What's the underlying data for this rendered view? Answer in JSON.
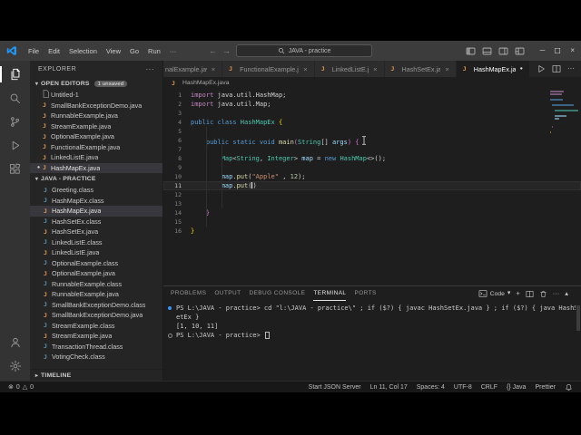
{
  "window": {
    "menus": [
      "File",
      "Edit",
      "Selection",
      "View",
      "Go",
      "Run",
      "···"
    ],
    "search_title": "JAVA - practice",
    "layout_icons": [
      "toggle-sidebar",
      "toggle-panel",
      "toggle-secondary-sidebar",
      "customize-layout"
    ],
    "window_controls": [
      "minimize",
      "maximize",
      "close"
    ]
  },
  "activity_bar": {
    "top": [
      "explorer",
      "search",
      "source-control",
      "run-debug",
      "extensions"
    ],
    "bottom": [
      "account",
      "settings"
    ],
    "active": "explorer"
  },
  "sidebar": {
    "title": "EXPLORER",
    "open_editors": {
      "label": "OPEN EDITORS",
      "badge": "1 unsaved",
      "items": [
        {
          "name": "Untitled-1",
          "icon": "file"
        },
        {
          "name": "SmallBankExceptionDemo.java",
          "icon": "java"
        },
        {
          "name": "RunnableExample.java",
          "icon": "java"
        },
        {
          "name": "StreamExample.java",
          "icon": "java"
        },
        {
          "name": "OptionalExample.java",
          "icon": "java"
        },
        {
          "name": "FunctionalExample.java",
          "icon": "java"
        },
        {
          "name": "LinkedListE.java",
          "icon": "java"
        },
        {
          "name": "HashMapEx.java",
          "icon": "java",
          "modified": true,
          "active": true
        }
      ]
    },
    "project": {
      "label": "JAVA - PRACTICE",
      "items": [
        {
          "name": "Greeting.class",
          "icon": "class"
        },
        {
          "name": "HashMapEx.class",
          "icon": "class"
        },
        {
          "name": "HashMapEx.java",
          "icon": "java",
          "selected": true
        },
        {
          "name": "HashSetEx.class",
          "icon": "class"
        },
        {
          "name": "HashSetEx.java",
          "icon": "java"
        },
        {
          "name": "LinkedListE.class",
          "icon": "class"
        },
        {
          "name": "LinkedListE.java",
          "icon": "java"
        },
        {
          "name": "OptionalExample.class",
          "icon": "class"
        },
        {
          "name": "OptionalExample.java",
          "icon": "java"
        },
        {
          "name": "RunnableExample.class",
          "icon": "class"
        },
        {
          "name": "RunnableExample.java",
          "icon": "java"
        },
        {
          "name": "SmallBankExceptionDemo.class",
          "icon": "class"
        },
        {
          "name": "SmallBankExceptionDemo.java",
          "icon": "java"
        },
        {
          "name": "StreamExample.class",
          "icon": "class"
        },
        {
          "name": "StreamExample.java",
          "icon": "java"
        },
        {
          "name": "TransactionThread.class",
          "icon": "class"
        },
        {
          "name": "VotingCheck.class",
          "icon": "class"
        }
      ]
    },
    "timeline_label": "TIMELINE"
  },
  "editor": {
    "tabs": [
      {
        "label": "nalExample.java",
        "partial": true
      },
      {
        "label": "FunctionalExample.java",
        "icon": "java"
      },
      {
        "label": "LinkedListE.jav",
        "icon": "java"
      },
      {
        "label": "HashSetEx.java",
        "icon": "java"
      },
      {
        "label": "HashMapEx.java",
        "icon": "java",
        "active": true,
        "modified": true
      }
    ],
    "tab_actions": [
      "run",
      "split-editor",
      "more"
    ],
    "breadcrumb": "HashMapEx.java",
    "lines": [
      {
        "n": "1",
        "seg": [
          [
            "import ",
            "ctrl"
          ],
          [
            "java.util.HashMap;",
            "plain"
          ]
        ]
      },
      {
        "n": "2",
        "seg": [
          [
            "import ",
            "ctrl"
          ],
          [
            "java.util.Map;",
            "plain"
          ]
        ]
      },
      {
        "n": "3",
        "seg": []
      },
      {
        "n": "4",
        "seg": [
          [
            "public class ",
            "kw"
          ],
          [
            "HashMapEx ",
            "type"
          ],
          [
            "{",
            "brace1"
          ]
        ]
      },
      {
        "n": "5",
        "seg": []
      },
      {
        "n": "6",
        "seg": [
          [
            "    ",
            "plain"
          ],
          [
            "public static void ",
            "kw"
          ],
          [
            "main",
            "fn"
          ],
          [
            "(",
            "brace2"
          ],
          [
            "String",
            "type"
          ],
          [
            "[] ",
            "plain"
          ],
          [
            "args",
            "var"
          ],
          [
            ") ",
            "brace2"
          ],
          [
            "{",
            "brace2"
          ],
          [
            "",
            "ibeam"
          ]
        ]
      },
      {
        "n": "7",
        "seg": []
      },
      {
        "n": "8",
        "seg": [
          [
            "        ",
            "plain"
          ],
          [
            "Map",
            "type"
          ],
          [
            "<",
            "plain"
          ],
          [
            "String",
            "type"
          ],
          [
            ", ",
            "plain"
          ],
          [
            "Integer",
            "type"
          ],
          [
            "> ",
            "plain"
          ],
          [
            "map",
            "var"
          ],
          [
            " = ",
            "plain"
          ],
          [
            "new ",
            "kw"
          ],
          [
            "HashMap",
            "type"
          ],
          [
            "<>();",
            "plain"
          ]
        ]
      },
      {
        "n": "9",
        "seg": []
      },
      {
        "n": "10",
        "seg": [
          [
            "        ",
            "plain"
          ],
          [
            "map",
            "var"
          ],
          [
            ".",
            "plain"
          ],
          [
            "put",
            "fn"
          ],
          [
            "(",
            "plain"
          ],
          [
            "\"Apple\"",
            "str"
          ],
          [
            " , ",
            "plain"
          ],
          [
            "12",
            "num"
          ],
          [
            ");",
            "plain"
          ]
        ]
      },
      {
        "n": "11",
        "current": true,
        "seg": [
          [
            "        ",
            "plain"
          ],
          [
            "map",
            "var"
          ],
          [
            ".",
            "plain"
          ],
          [
            "put",
            "fn"
          ],
          [
            "(",
            "plain"
          ],
          [
            "",
            "cursor"
          ],
          [
            ")",
            "plain"
          ]
        ]
      },
      {
        "n": "12",
        "seg": []
      },
      {
        "n": "13",
        "seg": []
      },
      {
        "n": "14",
        "seg": [
          [
            "    }",
            "brace2"
          ]
        ]
      },
      {
        "n": "15",
        "seg": []
      },
      {
        "n": "16",
        "seg": [
          [
            "}",
            "brace1"
          ]
        ]
      }
    ]
  },
  "panel": {
    "tabs": [
      "PROBLEMS",
      "OUTPUT",
      "DEBUG CONSOLE",
      "TERMINAL",
      "PORTS"
    ],
    "active_tab": "TERMINAL",
    "shell_name": "Code",
    "actions": [
      "new-terminal",
      "split-terminal",
      "kill-terminal",
      "more",
      "maximize-panel",
      "close-panel"
    ],
    "terminal_lines": [
      {
        "decor": "filled",
        "text": "PS L:\\JAVA - practice> cd \"l:\\JAVA - practice\\\" ; if ($?) { javac HashSetEx.java } ; if ($?) { java HashS"
      },
      {
        "text": "etEx }"
      },
      {
        "text": "[1, 10, 11]"
      },
      {
        "decor": "outline",
        "text": "PS L:\\JAVA - practice> ",
        "cursor": true
      }
    ]
  },
  "status_bar": {
    "errors": "0",
    "warnings": "0",
    "items": [
      "Start JSON Server",
      "Ln 11, Col 17",
      "Spaces: 4",
      "UTF-8",
      "CRLF",
      "{} Java",
      "Prettier"
    ]
  },
  "icons": {
    "java-letter": "J",
    "chevron-down": "▾",
    "chevron-right": "▸",
    "modified-dot": "●",
    "close": "×",
    "error": "⊗",
    "warning": "△",
    "back": "←",
    "forward": "→",
    "more": "···",
    "minimize": "─",
    "maximize-panel": "▴",
    "new-terminal": "+"
  },
  "colors": {
    "accent": "#3794ff",
    "java_icon": "#e8984a",
    "class_icon": "#519aba"
  }
}
